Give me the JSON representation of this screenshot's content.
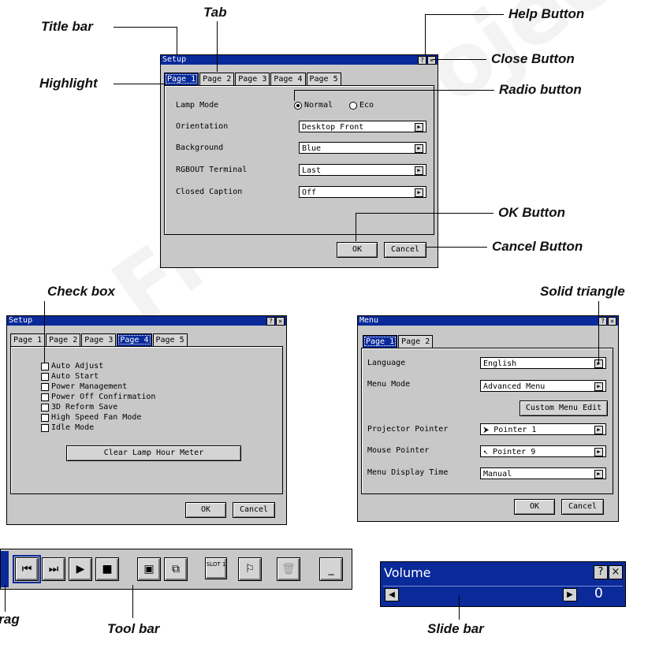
{
  "watermark": "From Projector",
  "callouts": {
    "title_bar": "Title bar",
    "tab": "Tab",
    "help_button": "Help Button",
    "close_button": "Close Button",
    "highlight": "Highlight",
    "radio_button": "Radio button",
    "ok_button": "OK Button",
    "cancel_button": "Cancel Button",
    "check_box": "Check box",
    "solid_triangle": "Solid triangle",
    "drag": "Drag",
    "tool_bar": "Tool bar",
    "slide_bar": "Slide bar"
  },
  "setup_window": {
    "title": "Setup",
    "help": "?",
    "close": "×",
    "tabs": [
      "Page 1",
      "Page 2",
      "Page 3",
      "Page 4",
      "Page 5"
    ],
    "lamp_mode_label": "Lamp Mode",
    "lamp_options": [
      "Normal",
      "Eco"
    ],
    "lamp_selected": "Normal",
    "rows": [
      {
        "label": "Orientation",
        "value": "Desktop Front"
      },
      {
        "label": "Background",
        "value": "Blue"
      },
      {
        "label": "RGBOUT Terminal",
        "value": "Last"
      },
      {
        "label": "Closed Caption",
        "value": "Off"
      }
    ],
    "ok": "OK",
    "cancel": "Cancel"
  },
  "setup_window_page4": {
    "title": "Setup",
    "help": "?",
    "close": "×",
    "tabs": [
      "Page 1",
      "Page 2",
      "Page 3",
      "Page 4",
      "Page 5"
    ],
    "checks": [
      "Auto Adjust",
      "Auto Start",
      "Power Management",
      "Power Off Confirmation",
      "3D Reform Save",
      "High Speed Fan Mode",
      "Idle Mode"
    ],
    "clear_button": "Clear Lamp Hour Meter",
    "ok": "OK",
    "cancel": "Cancel"
  },
  "menu_window": {
    "title": "Menu",
    "help": "?",
    "close": "×",
    "tabs": [
      "Page 1",
      "Page 2"
    ],
    "rows": [
      {
        "label": "Language",
        "value": "English"
      },
      {
        "label": "Menu Mode",
        "value": "Advanced Menu"
      }
    ],
    "custom_button": "Custom Menu Edit",
    "rows2": [
      {
        "label": "Projector Pointer",
        "value": "Pointer 1"
      },
      {
        "label": "Mouse Pointer",
        "value": "Pointer 9"
      },
      {
        "label": "Menu Display Time",
        "value": "Manual"
      }
    ],
    "ok": "OK",
    "cancel": "Cancel"
  },
  "toolbar": {
    "slot_label": "SLOT 1"
  },
  "volume": {
    "title": "Volume",
    "help": "?",
    "close": "×",
    "value": "0"
  },
  "colors": {
    "title_blue": "#0a2a9a",
    "window_gray": "#c8c8c8"
  }
}
